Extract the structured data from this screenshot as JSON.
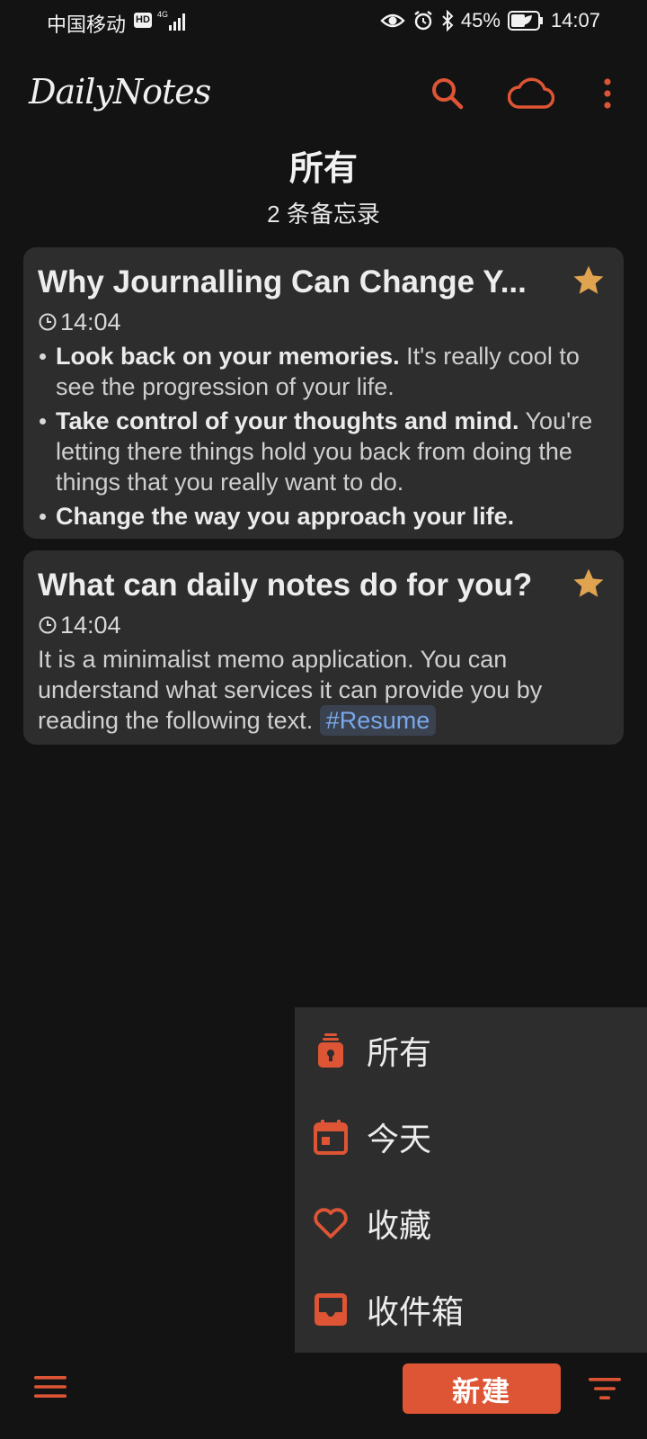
{
  "status_bar": {
    "carrier": "中国移动",
    "hd_badge": "HD",
    "network": "4G",
    "battery": "45%",
    "time": "14:07"
  },
  "app_bar": {
    "logo": "DailyNotes",
    "icons": [
      "search-icon",
      "cloud-icon",
      "more-vert-icon"
    ]
  },
  "list": {
    "title": "所有",
    "count": "2 条备忘录"
  },
  "notes": [
    {
      "title": "Why Journalling Can Change Y...",
      "starred": true,
      "time": "14:04",
      "bullets": [
        {
          "bold": "Look back on your memories.",
          "text": " It's really cool to see the progression of your life."
        },
        {
          "bold": "Take control of your thoughts and mind.",
          "text": " You're letting there things hold you back from doing the things that you really want to do."
        },
        {
          "bold": "Change the way you approach your life.",
          "text": ""
        }
      ]
    },
    {
      "title": "What can daily notes do for you?",
      "starred": true,
      "time": "14:04",
      "body": "It is a minimalist memo application. You can understand what services it can provide you by reading the following text. ",
      "tag": "#Resume"
    }
  ],
  "filter_menu": {
    "items": [
      {
        "label": "所有",
        "icon": "lightbulb-icon"
      },
      {
        "label": "今天",
        "icon": "calendar-icon"
      },
      {
        "label": "收藏",
        "icon": "heart-icon"
      },
      {
        "label": "收件箱",
        "icon": "inbox-icon"
      }
    ]
  },
  "bottom_bar": {
    "new_label": "新建"
  },
  "colors": {
    "accent": "#de5535",
    "star": "#e0a451",
    "background": "#131313",
    "card": "#2d2d2d",
    "tag_text": "#7aa7e8"
  }
}
